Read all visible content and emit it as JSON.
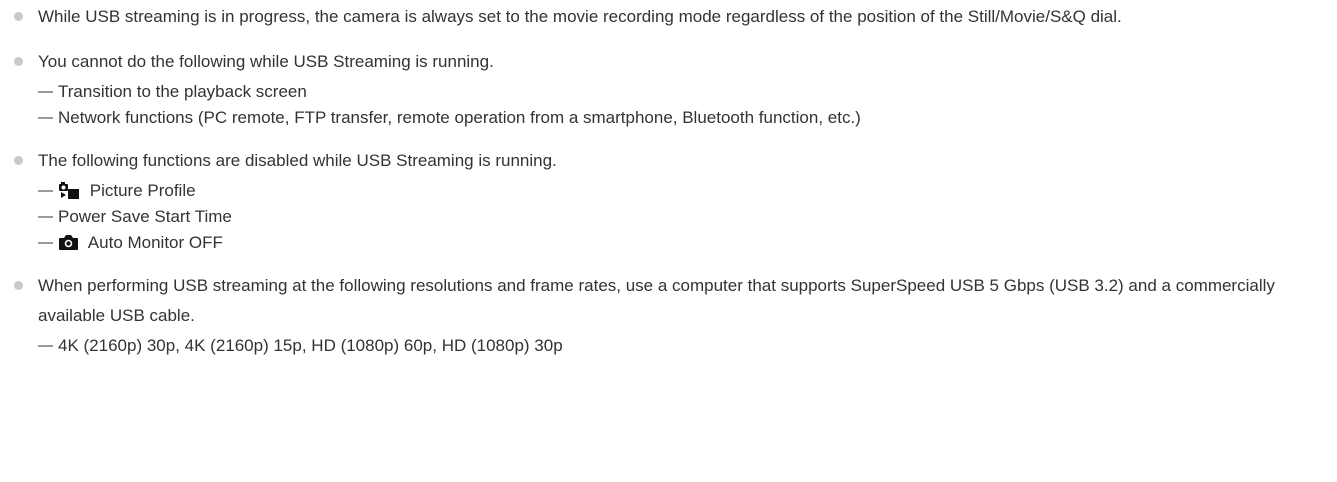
{
  "notes": [
    {
      "text": "While USB streaming is in progress, the camera is always set to the movie recording mode regardless of the position of the Still/Movie/S&Q dial.",
      "items": []
    },
    {
      "text": "You cannot do the following while USB Streaming is running.",
      "items": [
        {
          "label": "Transition to the playback screen"
        },
        {
          "label": "Network functions (PC remote, FTP transfer, remote operation from a smartphone, Bluetooth function, etc.)"
        }
      ]
    },
    {
      "text": "The following functions are disabled while USB Streaming is running.",
      "items": [
        {
          "label": "Picture Profile",
          "icon": "picture-profile-icon"
        },
        {
          "label": "Power Save Start Time"
        },
        {
          "label": "Auto Monitor OFF",
          "icon": "camera-icon"
        }
      ]
    },
    {
      "text": "When performing USB streaming at the following resolutions and frame rates, use a computer that supports SuperSpeed USB 5 Gbps (USB 3.2) and a commercially available USB cable.",
      "items": [
        {
          "label": "4K (2160p) 30p, 4K (2160p) 15p, HD (1080p) 60p, HD (1080p) 30p"
        }
      ]
    }
  ]
}
